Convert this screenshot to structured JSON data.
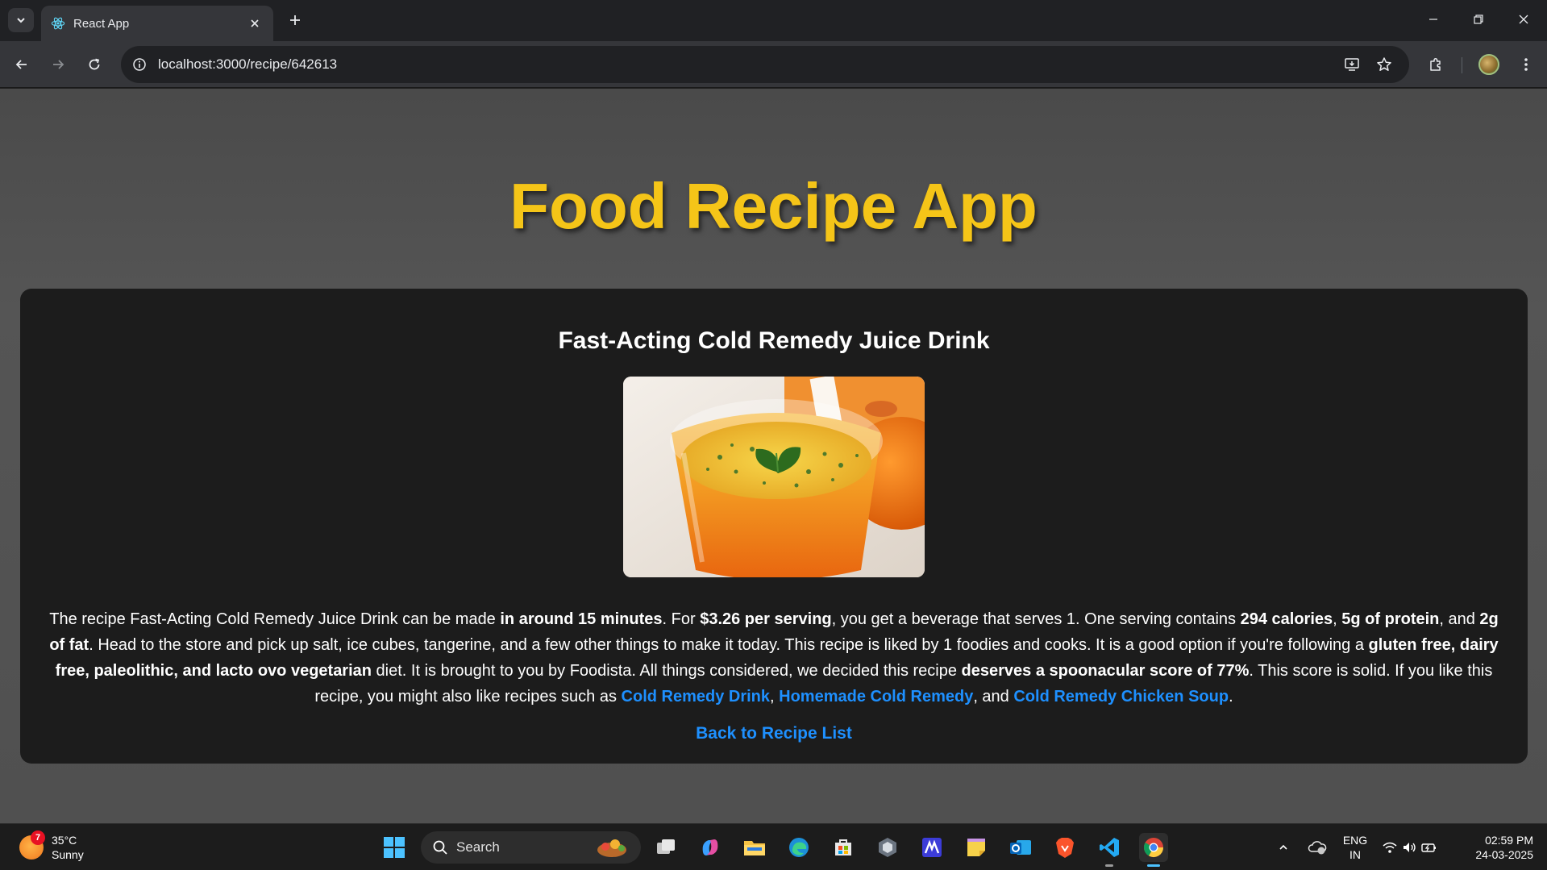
{
  "browser": {
    "tab_title": "React App",
    "url": "localhost:3000/recipe/642613"
  },
  "page": {
    "app_title": "Food Recipe App",
    "recipe_title": "Fast-Acting Cold Remedy Juice Drink",
    "summary": {
      "s1": "The recipe Fast-Acting Cold Remedy Juice Drink can be made ",
      "b1": "in around 15 minutes",
      "s2": ". For ",
      "b2": "$3.26 per serving",
      "s3": ", you get a beverage that serves 1. One serving contains ",
      "b3": "294 calories",
      "s4": ", ",
      "b4": "5g of protein",
      "s5": ", and ",
      "b5": "2g of fat",
      "s6": ". Head to the store and pick up salt, ice cubes, tangerine, and a few other things to make it today. This recipe is liked by 1 foodies and cooks. It is a good option if you're following a ",
      "b6": "gluten free, dairy free, paleolithic, and lacto ovo vegetarian",
      "s7": " diet. It is brought to you by Foodista. All things considered, we decided this recipe ",
      "b7": "deserves a spoonacular score of 77%",
      "s8": ". This score is solid. If you like this recipe, you might also like recipes such as ",
      "link1": "Cold Remedy Drink",
      "s9": ", ",
      "link2": "Homemade Cold Remedy",
      "s10": ", and ",
      "link3": "Cold Remedy Chicken Soup",
      "s11": "."
    },
    "back_link": "Back to Recipe List"
  },
  "taskbar": {
    "weather_temp": "35°C",
    "weather_desc": "Sunny",
    "weather_badge": "7",
    "search_label": "Search",
    "lang_top": "ENG",
    "lang_bottom": "IN",
    "time": "02:59 PM",
    "date": "24-03-2025"
  },
  "colors": {
    "title_yellow": "#f5c518",
    "link_blue": "#1e90ff",
    "card_bg": "#1c1c1c"
  }
}
